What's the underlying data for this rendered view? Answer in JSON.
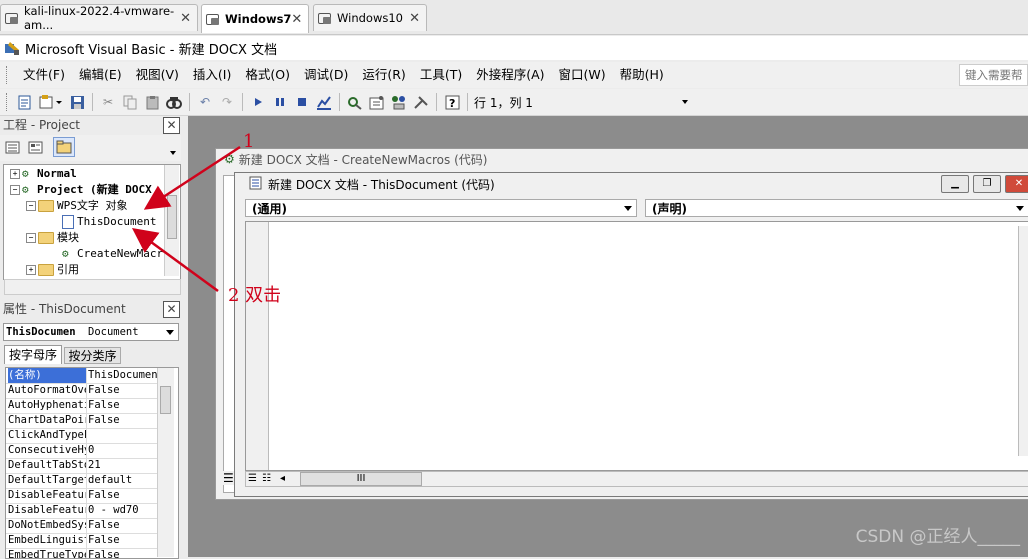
{
  "vm_tabs": [
    {
      "label": "kali-linux-2022.4-vmware-am..."
    },
    {
      "label": "Windows7"
    },
    {
      "label": "Windows10"
    }
  ],
  "title": "Microsoft Visual Basic - 新建 DOCX 文档",
  "menu": [
    "文件(F)",
    "编辑(E)",
    "视图(V)",
    "插入(I)",
    "格式(O)",
    "调试(D)",
    "运行(R)",
    "工具(T)",
    "外接程序(A)",
    "窗口(W)",
    "帮助(H)"
  ],
  "help_search_placeholder": "键入需要帮",
  "toolbar": {
    "cursor_pos": "行 1，列 1"
  },
  "project_panel": {
    "title": "工程 - Project",
    "tree": [
      "Normal",
      "Project (新建 DOCX",
      "WPS文字 对象",
      "ThisDocument",
      "模块",
      "CreateNewMacr",
      "引用"
    ]
  },
  "properties_panel": {
    "title": "属性 - ThisDocument",
    "object_name": "ThisDocumen",
    "object_type": "Document",
    "tabs": [
      "按字母序",
      "按分类序"
    ],
    "rows": [
      {
        "key": "(名称)",
        "value": "ThisDocument"
      },
      {
        "key": "AutoFormatOve",
        "value": "False"
      },
      {
        "key": "AutoHyphenati",
        "value": "False"
      },
      {
        "key": "ChartDataPoir",
        "value": "False"
      },
      {
        "key": "ClickAndTypeF",
        "value": ""
      },
      {
        "key": "ConsecutiveHy",
        "value": "0"
      },
      {
        "key": "DefaultTabSto",
        "value": "21"
      },
      {
        "key": "DefaultTarget",
        "value": "default"
      },
      {
        "key": "DisableFeatur",
        "value": "False"
      },
      {
        "key": "DisableFeatur",
        "value": "0 - wd70"
      },
      {
        "key": "DoNotEmbedSys",
        "value": "False"
      },
      {
        "key": "EmbedLinguist",
        "value": "False"
      },
      {
        "key": "EmbedTrueType",
        "value": "False"
      }
    ]
  },
  "back_window_title": "新建 DOCX 文档 - CreateNewMacros (代码)",
  "code_window": {
    "title": "新建 DOCX 文档 - ThisDocument (代码)",
    "object_combo": "(通用)",
    "proc_combo": "(声明)",
    "scroll_thumb": "III"
  },
  "annotations": {
    "step1": "1",
    "step2": "2  双击"
  },
  "watermark": "CSDN @正经人_____"
}
